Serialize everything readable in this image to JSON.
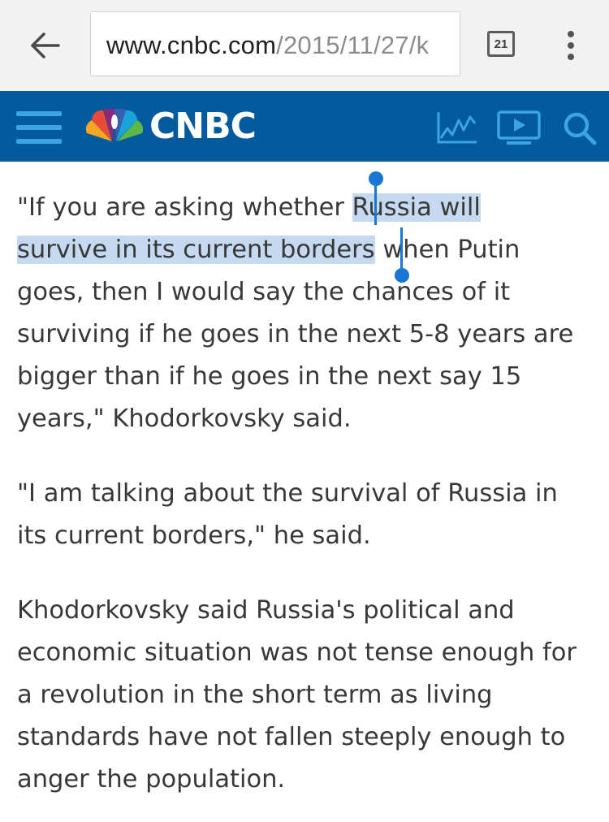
{
  "browser": {
    "url_domain": "www.cnbc.com",
    "url_path": "/2015/11/27/k",
    "tab_count": "21"
  },
  "header": {
    "logo_text": "CNBC"
  },
  "article": {
    "p1_before": "\"If you are asking whether ",
    "p1_selected_1": "Russia will",
    "p1_selected_2": "survive in its current borders",
    "p1_after": " when Putin goes, then I would say the chances of it surviving if he goes in the next 5-8 years are bigger than if he goes in the next say 15 years,\" Khodorkovsky said.",
    "p2": "\"I am talking about the survival of Russia in its current borders,\" he said.",
    "p3": "Khodorkovsky said Russia's political and economic situation was not tense enough for a revolution in the short term as living standards have not fallen steeply enough to anger the population."
  },
  "colors": {
    "header_bg": "#035a9d",
    "selection": "#c5daf0",
    "handle": "#1976d2",
    "icon_blue": "#3aa5e0"
  }
}
